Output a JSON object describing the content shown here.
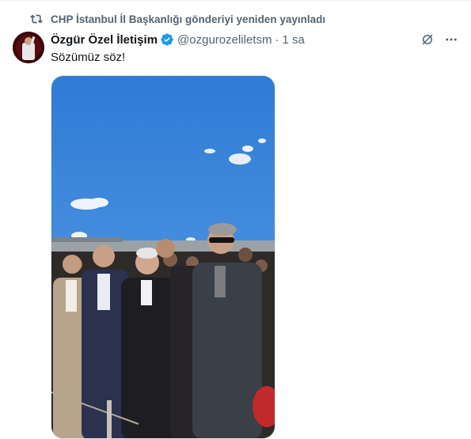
{
  "retweet": {
    "text": "CHP İstanbul İl Başkanlığı gönderiyi yeniden yayınladı"
  },
  "author": {
    "display_name": "Özgür Özel İletişim",
    "handle": "@ozgurozeliletsm",
    "separator": "·",
    "time": "1 sa"
  },
  "tweet": {
    "text": "Sözümüz söz!"
  },
  "icons": {
    "retweet": "retweet-icon",
    "verified": "verified-badge-icon",
    "grok": "grok-icon",
    "more": "more-icon"
  },
  "colors": {
    "secondary_text": "#536471",
    "verified": "#1d9bf0",
    "sky": "#3f86d8"
  }
}
